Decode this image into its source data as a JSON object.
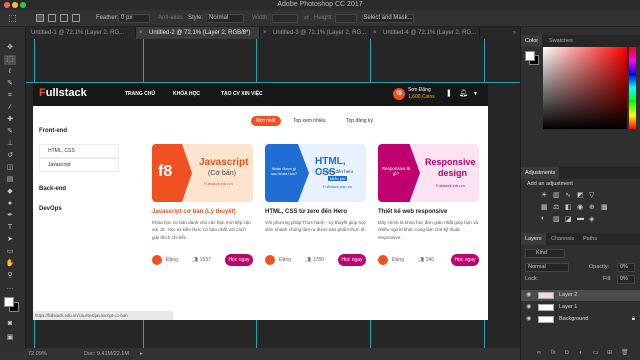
{
  "app": {
    "title": "Adobe Photoshop CC 2017"
  },
  "options": {
    "feather_label": "Feather:",
    "feather_value": "0 px",
    "antialias_label": "Anti-alias",
    "style_label": "Style:",
    "style_value": "Normal",
    "width_label": "Width:",
    "height_label": "Height:",
    "select_mask": "Select and Mask..."
  },
  "tabs": [
    {
      "label": "Untitled-1 @ 72.1% (Layer 2, RG..."
    },
    {
      "label": "Untitled-2 @ 72.1% (Layer 2, RGB/8*)"
    },
    {
      "label": "Untitled-3 @ 72.1% (Layer 2, RG..."
    },
    {
      "label": "Untitled-4 @ 72.1% (Layer 2, RG..."
    }
  ],
  "tab_close": "×",
  "site": {
    "logo_a": "F",
    "logo_b": "ull",
    "logo_c": "stack",
    "nav": [
      "TRANG CHỦ",
      "KHÓA HỌC",
      "TẠO CV XIN VIỆC"
    ],
    "user_initial": "f8",
    "user_name": "Sơn Đặng",
    "user_coins": "1,600 Coins",
    "sidebar": {
      "group1": "Front-end",
      "items": [
        "HTML, CSS",
        "Javascript"
      ],
      "group2": "Back-end",
      "group3": "DevOps"
    },
    "filters": [
      "Mới nhất",
      "Top xem nhiều",
      "Top đăng ký"
    ],
    "cards": [
      {
        "thumb_title": "Javascript",
        "thumb_sub": "(Cơ bản)",
        "thumb_url": "Fullstack.edu.vn",
        "name": "Javascript cơ bản (Lý thuyết)",
        "desc": "Khóa học cơ bản dành cho các bạn mới tiếp cận với JS. Học từ kiến thức cơ bản nhất với cách giải thích chi tiết.",
        "author": "Đặng",
        "count": "1537",
        "btn": "Học ngay"
      },
      {
        "thumb_tag": "Nhận được gì sau khóa học?",
        "thumb_title": "HTML, CSS",
        "thumb_sub": "từ zero đến hero",
        "thumb_sub2": "Miễn phí",
        "thumb_url": "Fullstack.edu.vn",
        "name": "HTML, CSS từ zero đến Hero",
        "desc": "Với phương pháp Thực hành - Lý thuyết giúp học viên nhanh chóng làm ra được sản phẩm thực tế.",
        "author": "Đặng",
        "count": "1780",
        "btn": "Học ngay"
      },
      {
        "thumb_tag": "Responsive là gì?",
        "thumb_title": "Responsive",
        "thumb_sub": "design",
        "thumb_url": "Fullstack.edu.vn",
        "name": "Thiết kế web responsive",
        "desc": "Đây chính là khóa học đơn giản nhất giúp bạn và nhiều người khác cùng làm chủ kỹ thuật responsive.",
        "author": "Đặng",
        "count": "246",
        "btn": "Học ngay"
      }
    ],
    "url": "https://fullstack.edu.vn/courses/javascript-co-ban"
  },
  "panels": {
    "color_tabs": [
      "Color",
      "Swatches"
    ],
    "adjust_tab": "Adjustments",
    "adjust_label": "Add an adjustment",
    "layer_tabs": [
      "Layers",
      "Channels",
      "Paths"
    ],
    "kind": "Kind",
    "blend": "Normal",
    "opacity_label": "Opacity:",
    "opacity": "0%",
    "lock_label": "Lock:",
    "fill_label": "Fill:",
    "fill": "0%",
    "layers": [
      {
        "name": "Layer 2"
      },
      {
        "name": "Layer 1"
      },
      {
        "name": "Background"
      }
    ]
  },
  "status": {
    "zoom": "72.09%",
    "doc": "Doc: 9.41M/22.1M"
  },
  "colors": {
    "brand": "#f05123",
    "btn": "#c1006f",
    "guide": "#21c7d6"
  }
}
